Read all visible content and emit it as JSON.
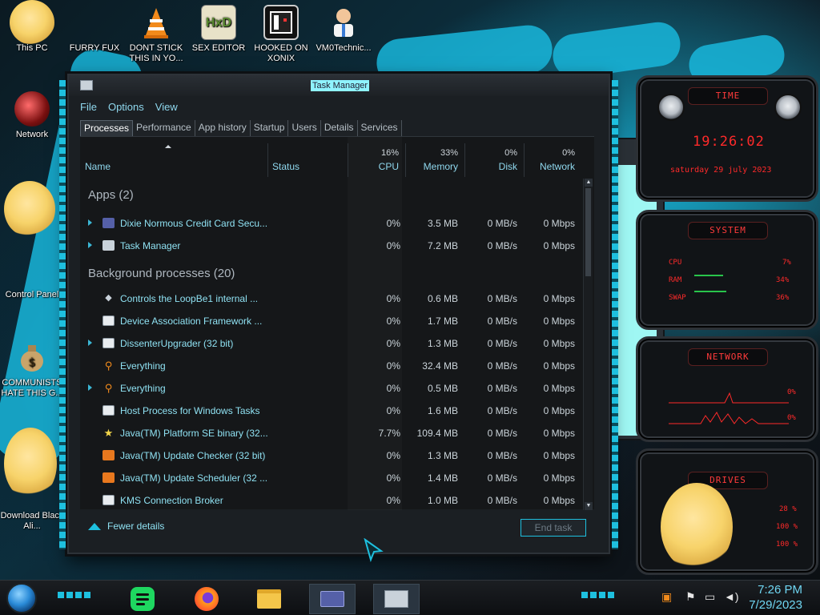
{
  "desktop": {
    "icons": [
      {
        "label": "This PC"
      },
      {
        "label": "FURRY FUX"
      },
      {
        "label": "DONT STICK THIS IN YO..."
      },
      {
        "label": "SEX EDITOR"
      },
      {
        "label": "HOOKED ON XONIX"
      },
      {
        "label": "VM0Technic..."
      },
      {
        "label": "Network"
      },
      {
        "label": "Control Panel"
      },
      {
        "label": "COMMUNISTS HATE THIS G..."
      },
      {
        "label": "Download Black Ali..."
      }
    ]
  },
  "task_manager": {
    "title": "Task Manager",
    "menu": [
      "File",
      "Options",
      "View"
    ],
    "tabs": [
      "Processes",
      "Performance",
      "App history",
      "Startup",
      "Users",
      "Details",
      "Services"
    ],
    "active_tab": "Processes",
    "columns": {
      "name": "Name",
      "status": "Status",
      "cpu": {
        "label": "CPU",
        "total": "16%"
      },
      "memory": {
        "label": "Memory",
        "total": "33%"
      },
      "disk": {
        "label": "Disk",
        "total": "0%"
      },
      "network": {
        "label": "Network",
        "total": "0%"
      }
    },
    "groups": {
      "apps": {
        "header": "Apps (2)",
        "rows": [
          {
            "name": "Dixie Normous Credit Card Secu...",
            "cpu": "0%",
            "memory": "3.5 MB",
            "disk": "0 MB/s",
            "network": "0 Mbps",
            "expand": true,
            "icon": "card-icon"
          },
          {
            "name": "Task Manager",
            "cpu": "0%",
            "memory": "7.2 MB",
            "disk": "0 MB/s",
            "network": "0 Mbps",
            "expand": true,
            "icon": "taskmgr-icon"
          }
        ]
      },
      "background": {
        "header": "Background processes (20)",
        "rows": [
          {
            "name": "Controls the LoopBe1 internal ...",
            "cpu": "0%",
            "memory": "0.6 MB",
            "disk": "0 MB/s",
            "network": "0 Mbps",
            "expand": false,
            "icon": "audio-icon"
          },
          {
            "name": "Device Association Framework ...",
            "cpu": "0%",
            "memory": "1.7 MB",
            "disk": "0 MB/s",
            "network": "0 Mbps",
            "expand": false,
            "icon": "window-icon"
          },
          {
            "name": "DissenterUpgrader (32 bit)",
            "cpu": "0%",
            "memory": "1.3 MB",
            "disk": "0 MB/s",
            "network": "0 Mbps",
            "expand": true,
            "icon": "window-icon"
          },
          {
            "name": "Everything",
            "cpu": "0%",
            "memory": "32.4 MB",
            "disk": "0 MB/s",
            "network": "0 Mbps",
            "expand": false,
            "icon": "magnifier-icon"
          },
          {
            "name": "Everything",
            "cpu": "0%",
            "memory": "0.5 MB",
            "disk": "0 MB/s",
            "network": "0 Mbps",
            "expand": true,
            "icon": "magnifier-icon"
          },
          {
            "name": "Host Process for Windows Tasks",
            "cpu": "0%",
            "memory": "1.6 MB",
            "disk": "0 MB/s",
            "network": "0 Mbps",
            "expand": false,
            "icon": "window-icon"
          },
          {
            "name": "Java(TM) Platform SE binary (32...",
            "cpu": "7.7%",
            "memory": "109.4 MB",
            "disk": "0 MB/s",
            "network": "0 Mbps",
            "expand": false,
            "icon": "star-icon"
          },
          {
            "name": "Java(TM) Update Checker (32 bit)",
            "cpu": "0%",
            "memory": "1.3 MB",
            "disk": "0 MB/s",
            "network": "0 Mbps",
            "expand": false,
            "icon": "java-icon"
          },
          {
            "name": "Java(TM) Update Scheduler (32 ...",
            "cpu": "0%",
            "memory": "1.4 MB",
            "disk": "0 MB/s",
            "network": "0 Mbps",
            "expand": false,
            "icon": "java-icon"
          },
          {
            "name": "KMS Connection Broker",
            "cpu": "0%",
            "memory": "1.0 MB",
            "disk": "0 MB/s",
            "network": "0 Mbps",
            "expand": false,
            "icon": "window-icon"
          }
        ]
      }
    },
    "footer": {
      "fewer_details": "Fewer details",
      "end_task": "End task"
    }
  },
  "gadgets": {
    "time": {
      "head": "TIME",
      "clock": "19:26:02",
      "date": "saturday 29 july 2023"
    },
    "system": {
      "head": "SYSTEM",
      "rows": [
        {
          "label": "CPU",
          "value": "7%"
        },
        {
          "label": "RAM",
          "value": "34%"
        },
        {
          "label": "SWAP",
          "value": "36%"
        }
      ]
    },
    "network": {
      "head": "NETWORK",
      "in": "0%",
      "out": "0%"
    },
    "drives": {
      "head": "DRIVES",
      "values": [
        "28 %",
        "100 %",
        "100 %"
      ]
    }
  },
  "taskbar": {
    "time": "7:26 PM",
    "date": "7/29/2023",
    "apps": [
      "spotify-icon",
      "firefox-icon",
      "file-explorer-icon",
      "card-app-icon",
      "task-manager-icon"
    ]
  },
  "colors": {
    "accent": "#1ec0df",
    "text_cyan": "#8fe1f2",
    "gadget_red": "#ff2a2a"
  }
}
